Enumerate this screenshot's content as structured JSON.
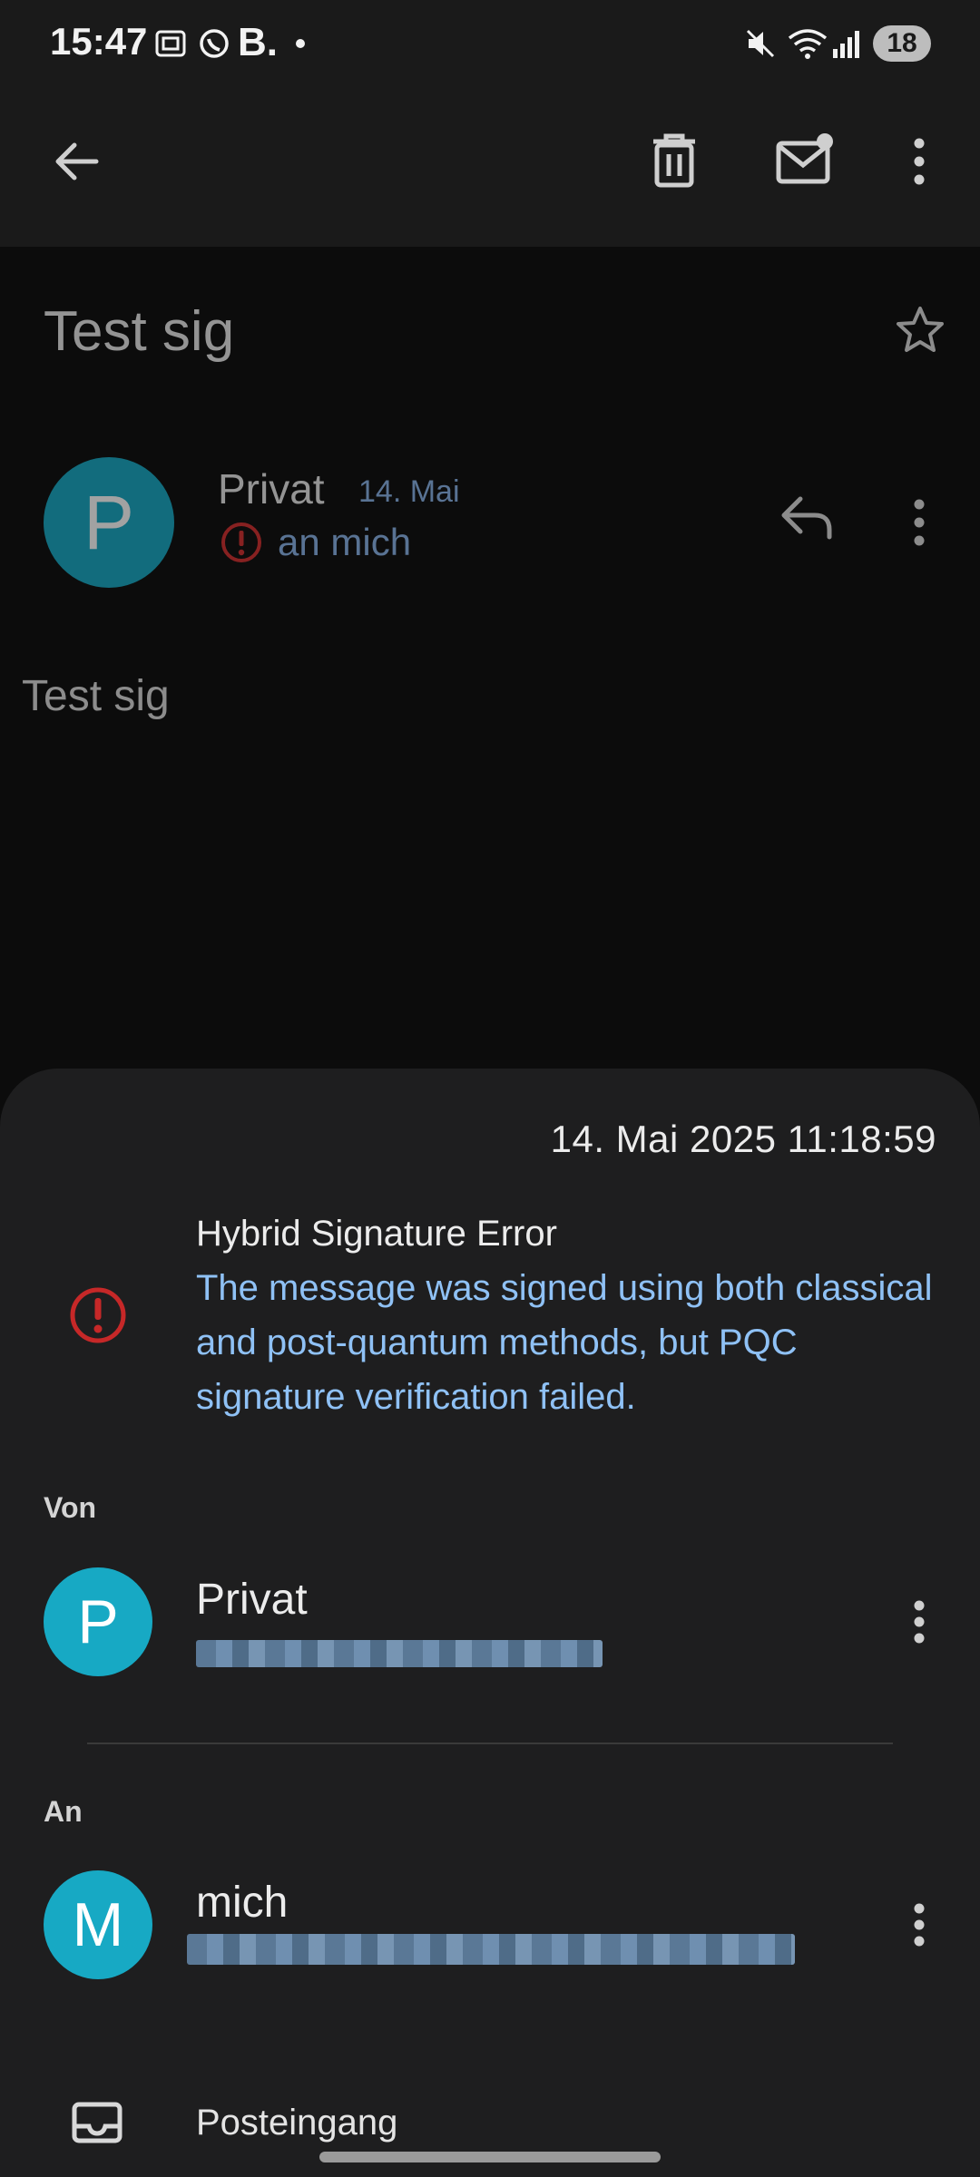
{
  "status_bar": {
    "time": "15:47",
    "battery": "18"
  },
  "app_bar": {
    "back_icon": "arrow-left-icon",
    "delete_icon": "trash-icon",
    "mark_unread_icon": "mail-unread-icon",
    "more_icon": "more-vert-icon"
  },
  "message": {
    "subject": "Test sig",
    "sender_initial": "P",
    "sender_name": "Privat",
    "date_short": "14. Mai",
    "to_line": "an mich",
    "body": "Test sig"
  },
  "details_sheet": {
    "timestamp": "14. Mai 2025 11:18:59",
    "signature_status": {
      "title": "Hybrid Signature Error",
      "description": "The message was signed using both classical and post-quantum methods, but PQC signature verification failed.",
      "status_color": "#c62828"
    },
    "from_label": "Von",
    "from_contact": {
      "initial": "P",
      "name": "Privat"
    },
    "to_label": "An",
    "to_contact": {
      "initial": "M",
      "name": "mich"
    },
    "folder": "Posteingang"
  },
  "colors": {
    "accent_link": "#8fc1f5",
    "avatar": "#17a9c4",
    "error": "#c62828"
  }
}
